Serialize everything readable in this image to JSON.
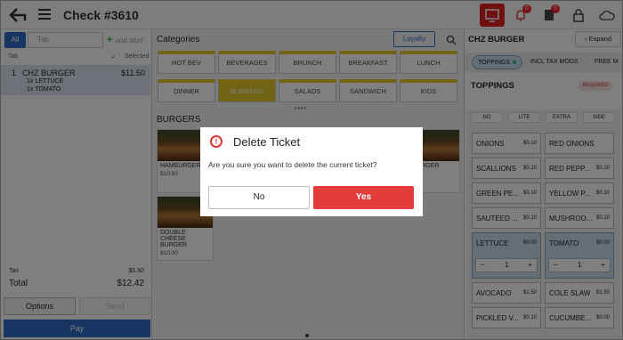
{
  "header": {
    "title": "Check #3610",
    "badges": {
      "notifications": "0",
      "list": "0"
    }
  },
  "left": {
    "tab_all": "All",
    "tab_placeholder": "Tab",
    "add_seat": "ADD SEAT",
    "tab_label": "Tab",
    "selected_label": "Selected",
    "item": {
      "qty": "1",
      "name": "CHZ BURGER",
      "price": "$11.50",
      "mods": [
        "1x LETTUCE",
        "1x TOMATO"
      ]
    },
    "tax_label": "Tax",
    "tax_value": "$0.92",
    "total_label": "Total",
    "total_value": "$12.42",
    "options": "Options",
    "send": "Send",
    "pay": "Pay"
  },
  "center": {
    "categories_title": "Categories",
    "loyalty": "Loyalty",
    "categories": [
      "HOT BEV",
      "BEVERAGES",
      "BRUNCH",
      "BREAKFAST",
      "LUNCH",
      "DINNER",
      "BURGERS",
      "SALADS",
      "SANDWICH",
      "KIDS"
    ],
    "selected_category": "BURGERS",
    "section_title": "BURGERS",
    "cards": [
      {
        "name": "HAMBURGER",
        "price": "$10.50"
      },
      {
        "name": "Y BURGER",
        "price": ""
      },
      {
        "name": "DOUBLE CHEESE BURGER",
        "price": "$10.00"
      }
    ]
  },
  "right": {
    "title": "CHZ BURGER",
    "expand": "Expand",
    "tabs": [
      "TOPPINGS",
      "INCL TAX MODS",
      "FREE M"
    ],
    "section": "TOPPINGS",
    "required": "REQUIRED",
    "mod_headers": [
      "NO",
      "LITE",
      "EXTRA",
      "SIDE"
    ],
    "options": [
      {
        "name": "ONIONS",
        "price": "$0.10"
      },
      {
        "name": "RED ONIONS",
        "price": ""
      },
      {
        "name": "SCALLIONS",
        "price": "$0.10"
      },
      {
        "name": "RED PEPP...",
        "price": "$0.10"
      },
      {
        "name": "GREEN PE...",
        "price": "$0.10"
      },
      {
        "name": "YELLOW P...",
        "price": "$0.10"
      },
      {
        "name": "SAUTEED ...",
        "price": "$0.10"
      },
      {
        "name": "MUSHROO...",
        "price": "$0.10"
      },
      {
        "name": "LETTUCE",
        "price": "$0.00",
        "qty": "1"
      },
      {
        "name": "TOMATO",
        "price": "$0.00",
        "qty": "1"
      },
      {
        "name": "AVOCADO",
        "price": "$1.50"
      },
      {
        "name": "COLE SLAW",
        "price": "$1.50"
      },
      {
        "name": "PICKLED V...",
        "price": "$0.10"
      },
      {
        "name": "CUCUMBE...",
        "price": "$0.00"
      }
    ]
  },
  "dialog": {
    "title": "Delete Ticket",
    "message": "Are you sure you want to delete the current ticket?",
    "no": "No",
    "yes": "Yes"
  },
  "colors": {
    "accent": "#2d6bc5",
    "category": "#e4c62b",
    "danger": "#e43b3b"
  }
}
